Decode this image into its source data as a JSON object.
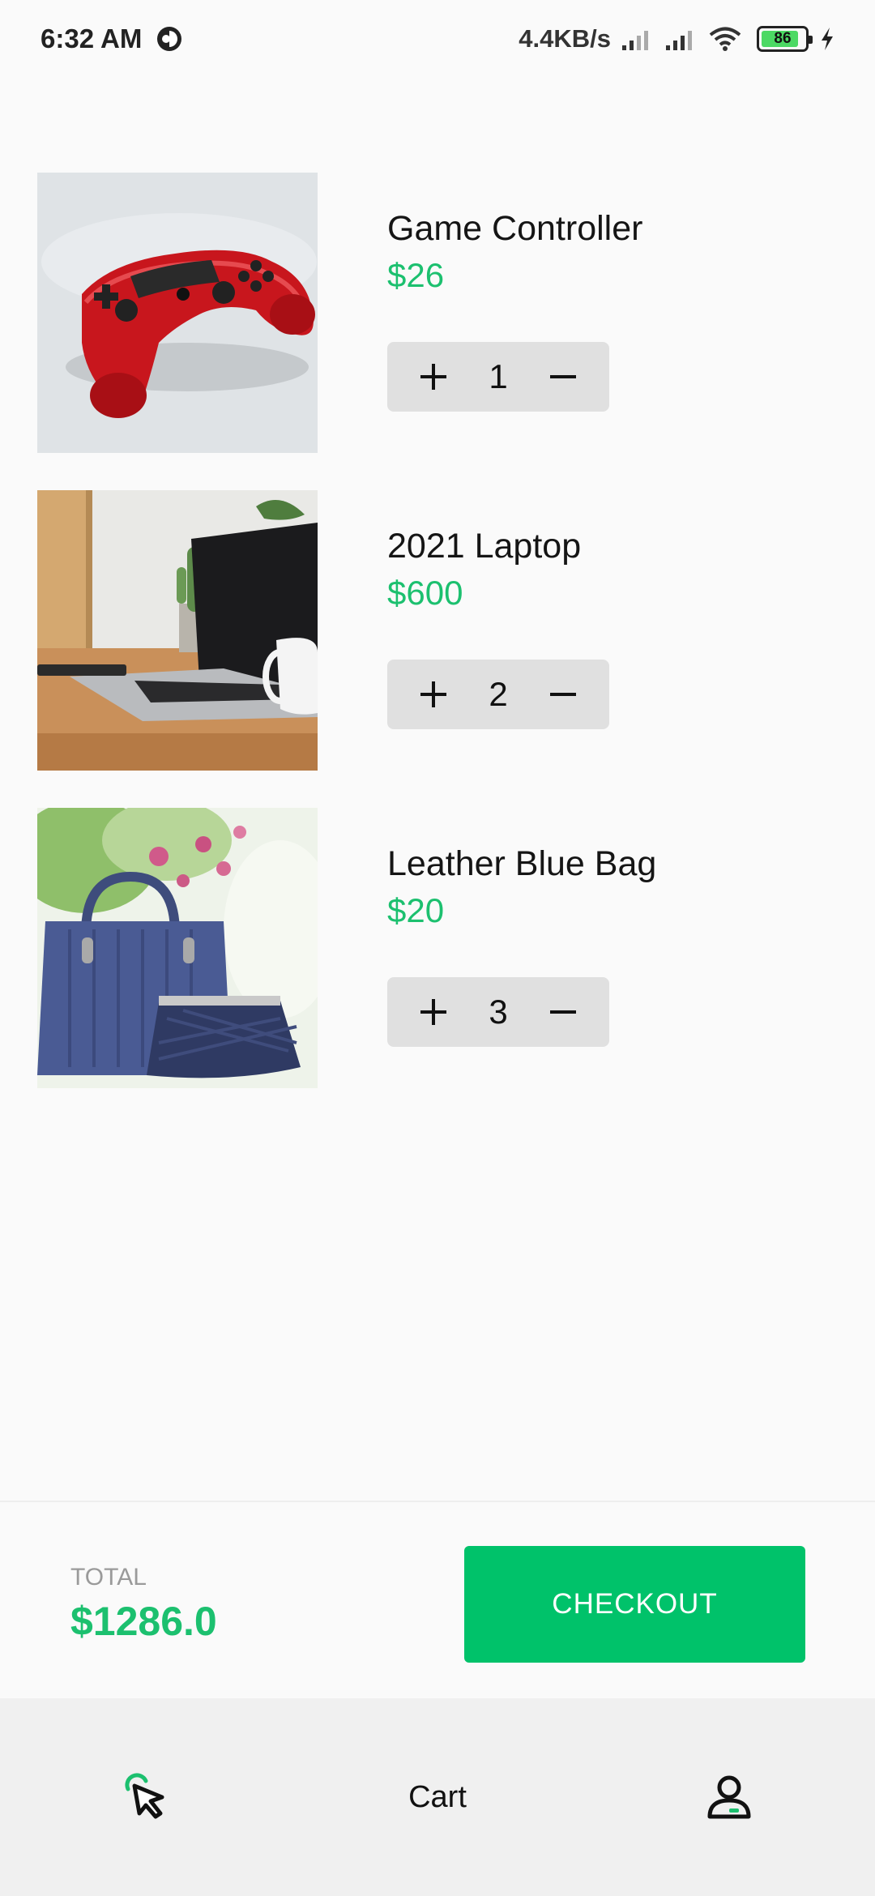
{
  "status_bar": {
    "time": "6:32 AM",
    "net_speed": "4.4KB/s",
    "battery_level": "86",
    "battery_fraction": 0.86
  },
  "cart": {
    "items": [
      {
        "name": "Game Controller",
        "price": "$26",
        "quantity": "1",
        "plus": "+",
        "minus": "−"
      },
      {
        "name": "2021 Laptop",
        "price": "$600",
        "quantity": "2",
        "plus": "+",
        "minus": "−"
      },
      {
        "name": "Leather Blue Bag",
        "price": "$20",
        "quantity": "3",
        "plus": "+",
        "minus": "−"
      }
    ]
  },
  "checkout": {
    "total_label": "TOTAL",
    "total_value": "$1286.0",
    "button_label": "CHECKOUT"
  },
  "nav": {
    "items": [
      {
        "icon": "cursor-click-icon",
        "label": ""
      },
      {
        "label": "Cart"
      },
      {
        "icon": "user-icon",
        "label": ""
      }
    ]
  },
  "colors": {
    "accent": "#00c26a",
    "price": "#1cc06f",
    "stepper_bg": "#e0e0e0"
  }
}
